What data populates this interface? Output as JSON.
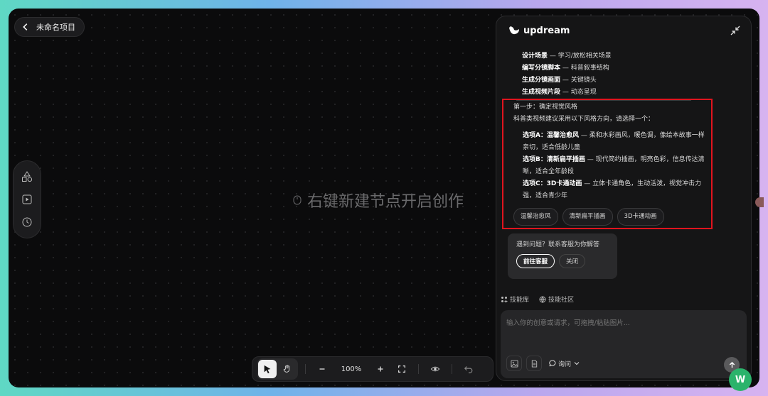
{
  "header": {
    "back_title": "未命名项目"
  },
  "canvas": {
    "hint": "右键新建节点开启创作"
  },
  "toolbar": {
    "zoom": "100%"
  },
  "panel": {
    "brand": "updream",
    "steps": [
      {
        "bold": "设计场景",
        "rest": " — 学习/放松相关场景"
      },
      {
        "bold": "编写分镜脚本",
        "rest": " — 科普叙事结构"
      },
      {
        "bold": "生成分镜画面",
        "rest": " — 关键镜头"
      },
      {
        "bold": "生成视频片段",
        "rest": " — 动态呈现"
      }
    ],
    "step_title": "第一步：确定视觉风格",
    "step_intro": "科普类视频建议采用以下风格方向，请选择一个：",
    "options": [
      {
        "bold": "选项A：温馨治愈风",
        "rest": " — 柔和水彩画风，暖色调，像绘本故事一样亲切，适合低龄儿童"
      },
      {
        "bold": "选项B：清新扁平插画",
        "rest": " — 现代简约插画，明亮色彩，信息传达清晰，适合全年龄段"
      },
      {
        "bold": "选项C：3D卡通动画",
        "rest": " — 立体卡通角色，生动活泼，视觉冲击力强，适合青少年"
      }
    ],
    "chips": [
      "温馨治愈风",
      "清新扁平插画",
      "3D卡通动画"
    ],
    "support": {
      "text": "遇到问题？联系客服为你解答",
      "go": "前往客服",
      "close": "关闭"
    },
    "links": {
      "skills": "技能库",
      "community": "技能社区"
    },
    "input": {
      "placeholder": "输入你的创意或请求，可拖拽/粘贴图片...",
      "mode": "询问"
    }
  },
  "fab_label": "W",
  "colors": {
    "highlight": "#e0141e",
    "fab": "#2bb36b"
  }
}
